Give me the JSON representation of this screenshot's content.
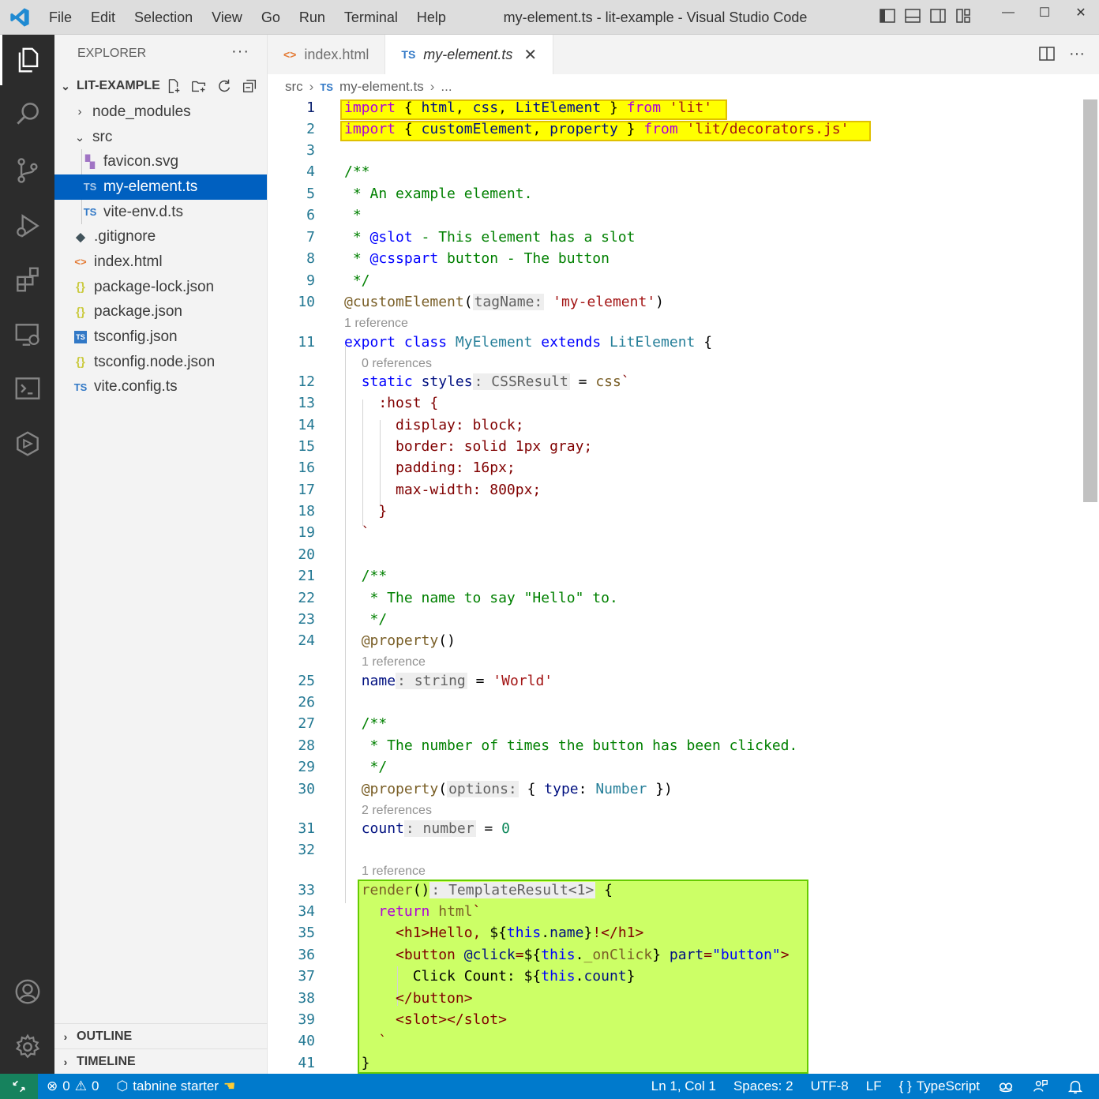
{
  "titlebar": {
    "menu": [
      "File",
      "Edit",
      "Selection",
      "View",
      "Go",
      "Run",
      "Terminal",
      "Help"
    ],
    "window_title": "my-element.ts - lit-example - Visual Studio Code",
    "controls": {
      "minimize": "—",
      "maximize": "☐",
      "close": "✕"
    }
  },
  "activitybar": {
    "items": [
      "explorer-icon",
      "search-icon",
      "source-control-icon",
      "run-debug-icon",
      "extensions-icon",
      "remote-explorer-icon",
      "terminal-icon",
      "tabnine-icon"
    ],
    "bottom": [
      "accounts-icon",
      "settings-gear-icon"
    ]
  },
  "sidebar": {
    "title": "EXPLORER",
    "more": "···",
    "folder": "LIT-EXAMPLE",
    "tree": [
      {
        "label": "node_modules",
        "kind": "folder-collapsed",
        "indent": 0,
        "icon": "›"
      },
      {
        "label": "src",
        "kind": "folder-open",
        "indent": 0,
        "icon": "⌄"
      },
      {
        "label": "favicon.svg",
        "kind": "svg",
        "indent": 1,
        "icon": "▚"
      },
      {
        "label": "my-element.ts",
        "kind": "ts",
        "indent": 1,
        "icon": "TS",
        "selected": true
      },
      {
        "label": "vite-env.d.ts",
        "kind": "ts",
        "indent": 1,
        "icon": "TS"
      },
      {
        "label": ".gitignore",
        "kind": "git",
        "indent": 0,
        "icon": "◆"
      },
      {
        "label": "index.html",
        "kind": "html",
        "indent": 0,
        "icon": "<>"
      },
      {
        "label": "package-lock.json",
        "kind": "json",
        "indent": 0,
        "icon": "{}"
      },
      {
        "label": "package.json",
        "kind": "json",
        "indent": 0,
        "icon": "{}"
      },
      {
        "label": "tsconfig.json",
        "kind": "tsconfig",
        "indent": 0,
        "icon": "TS"
      },
      {
        "label": "tsconfig.node.json",
        "kind": "json",
        "indent": 0,
        "icon": "{}"
      },
      {
        "label": "vite.config.ts",
        "kind": "ts",
        "indent": 0,
        "icon": "TS"
      }
    ],
    "outline": "OUTLINE",
    "timeline": "TIMELINE"
  },
  "tabs": [
    {
      "label": "index.html",
      "icon": "<>",
      "active": false
    },
    {
      "label": "my-element.ts",
      "icon": "TS",
      "active": true,
      "close": "✕"
    }
  ],
  "breadcrumb": {
    "folder": "src",
    "file_icon": "TS",
    "file": "my-element.ts",
    "more": "..."
  },
  "editor": {
    "line_numbers": [
      "1",
      "2",
      "3",
      "4",
      "5",
      "6",
      "7",
      "8",
      "9",
      "10",
      "11",
      "12",
      "13",
      "14",
      "15",
      "16",
      "17",
      "18",
      "19",
      "20",
      "21",
      "22",
      "23",
      "24",
      "25",
      "26",
      "27",
      "28",
      "29",
      "30",
      "31",
      "32",
      "33",
      "34",
      "35",
      "36",
      "37",
      "38",
      "39",
      "40",
      "41"
    ],
    "code_lens": {
      "after_10": "1 reference",
      "after_11": "0 references",
      "after_24": "1 reference",
      "after_30": "2 references",
      "after_32": "1 reference"
    }
  },
  "statusbar": {
    "errors": "0",
    "warnings": "0",
    "tabnine": "tabnine starter",
    "position": "Ln 1, Col 1",
    "spaces": "Spaces: 2",
    "encoding": "UTF-8",
    "eol": "LF",
    "language": "TypeScript",
    "lang_icon": "{ }"
  },
  "colors": {
    "accent": "#007acc",
    "activity_bar": "#2c2c2c",
    "selection": "#0060c0",
    "highlight_yellow": "#ffff00",
    "highlight_green": "#ccff66"
  }
}
